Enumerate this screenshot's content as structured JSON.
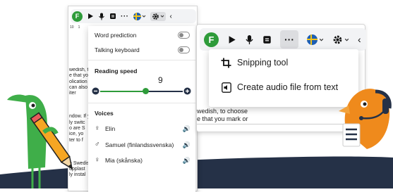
{
  "left_window": {
    "ruler_numbers": [
      "10",
      "1"
    ],
    "doc_lines": [
      "wedish, t",
      "e that yo",
      "olication i",
      "can also",
      "iter",
      "",
      "",
      "",
      "ndow. If y",
      "ly switc",
      "o are S",
      "ice, yo",
      "ter to f",
      "",
      "",
      "",
      "e Swedis",
      "upplast",
      "ly instal"
    ],
    "panel": {
      "word_prediction_label": "Word prediction",
      "talking_keyboard_label": "Talking keyboard",
      "reading_speed_label": "Reading speed",
      "speed_value": "9",
      "speed_slider_fraction": 0.55,
      "voices_label": "Voices",
      "voices": [
        {
          "name": "Elin",
          "gender": "female"
        },
        {
          "name": "Samuel (finlandssvenska)",
          "gender": "male"
        },
        {
          "name": "Mia (skånska)",
          "gender": "female"
        }
      ]
    }
  },
  "right_window": {
    "doc_lines": [
      "wedish, to choose",
      "e that you mark or"
    ],
    "menu": [
      {
        "label": "Snipping tool",
        "icon": "crop-icon"
      },
      {
        "label": "Create audio file from text",
        "icon": "audio-file-icon"
      }
    ]
  },
  "colors": {
    "brand_green": "#2e9b3a",
    "dark_navy": "#253147",
    "mascot_green": "#3fae49",
    "mascot_orange": "#ef8a1c",
    "slider_green": "#2e9b3a"
  }
}
